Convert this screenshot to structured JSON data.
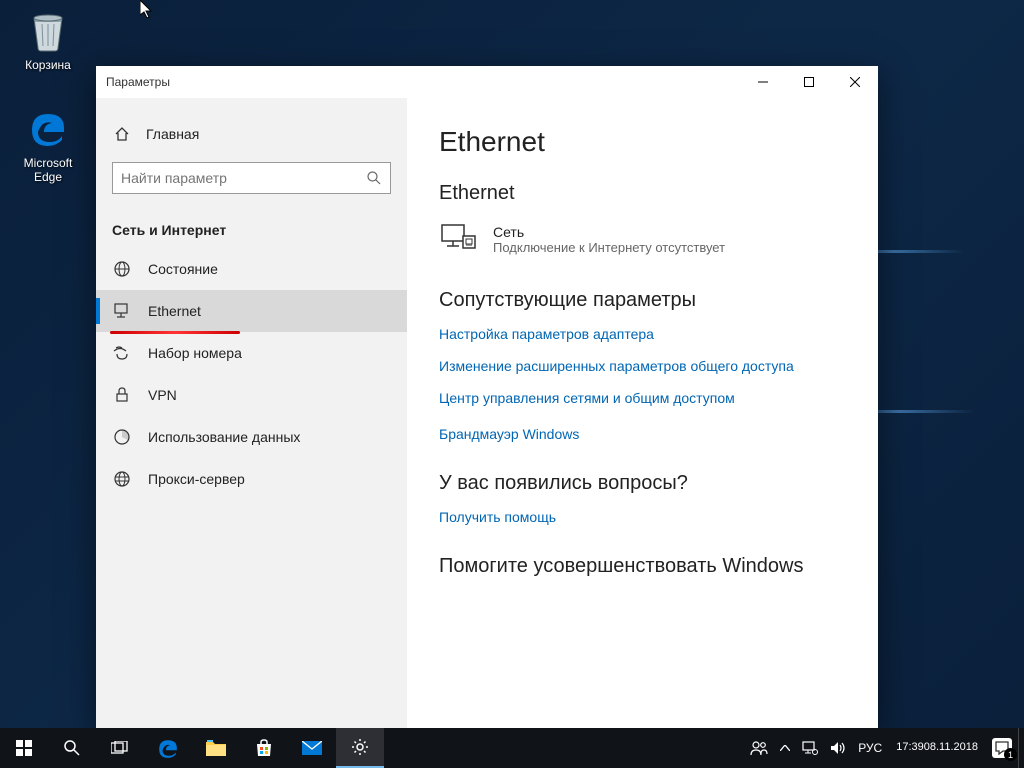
{
  "desktop": {
    "recycle": "Корзина",
    "edge": "Microsoft Edge"
  },
  "window": {
    "title": "Параметры"
  },
  "sidebar": {
    "home": "Главная",
    "search_placeholder": "Найти параметр",
    "category": "Сеть и Интернет",
    "items": [
      {
        "label": "Состояние"
      },
      {
        "label": "Ethernet"
      },
      {
        "label": "Набор номера"
      },
      {
        "label": "VPN"
      },
      {
        "label": "Использование данных"
      },
      {
        "label": "Прокси-сервер"
      }
    ]
  },
  "content": {
    "h1": "Ethernet",
    "h2_net": "Ethernet",
    "net_title": "Сеть",
    "net_sub": "Подключение к Интернету отсутствует",
    "related_h": "Сопутствующие параметры",
    "links": [
      "Настройка параметров адаптера",
      "Изменение расширенных параметров общего доступа",
      "Центр управления сетями и общим доступом",
      "Брандмауэр Windows"
    ],
    "questions_h": "У вас появились вопросы?",
    "help_link": "Получить помощь",
    "feedback_h": "Помогите усовершенствовать Windows"
  },
  "taskbar": {
    "lang": "РУС",
    "time": "17:39",
    "date": "08.11.2018",
    "notif_count": "1"
  }
}
